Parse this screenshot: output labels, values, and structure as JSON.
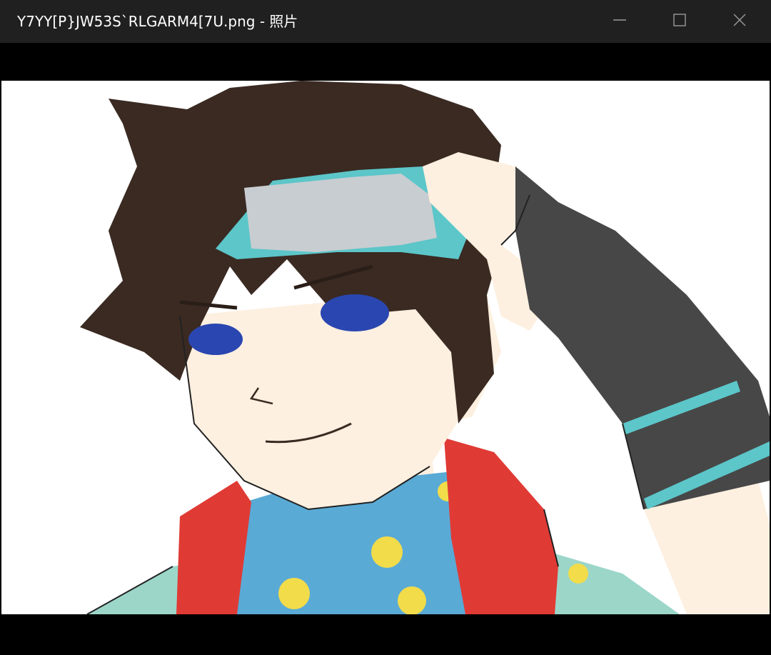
{
  "window": {
    "title": "Y7YY[P}JW53S`RLGARM4[7U.png - 照片",
    "controls": {
      "minimize": "minimize",
      "maximize": "maximize",
      "close": "close"
    }
  },
  "photo": {
    "subject": "anime-character-illustration",
    "colors": {
      "hair": "#3a2a22",
      "skin": "#fdf0e0",
      "headband": "#5cc6c9",
      "headband_plate": "#c8cdd1",
      "eyes": "#2a46b0",
      "scarf": "#e03a35",
      "collar": "#5aaad6",
      "collar_dots": "#f2dc4a",
      "glove": "#474747",
      "shirt": "#9bd6c9"
    }
  }
}
